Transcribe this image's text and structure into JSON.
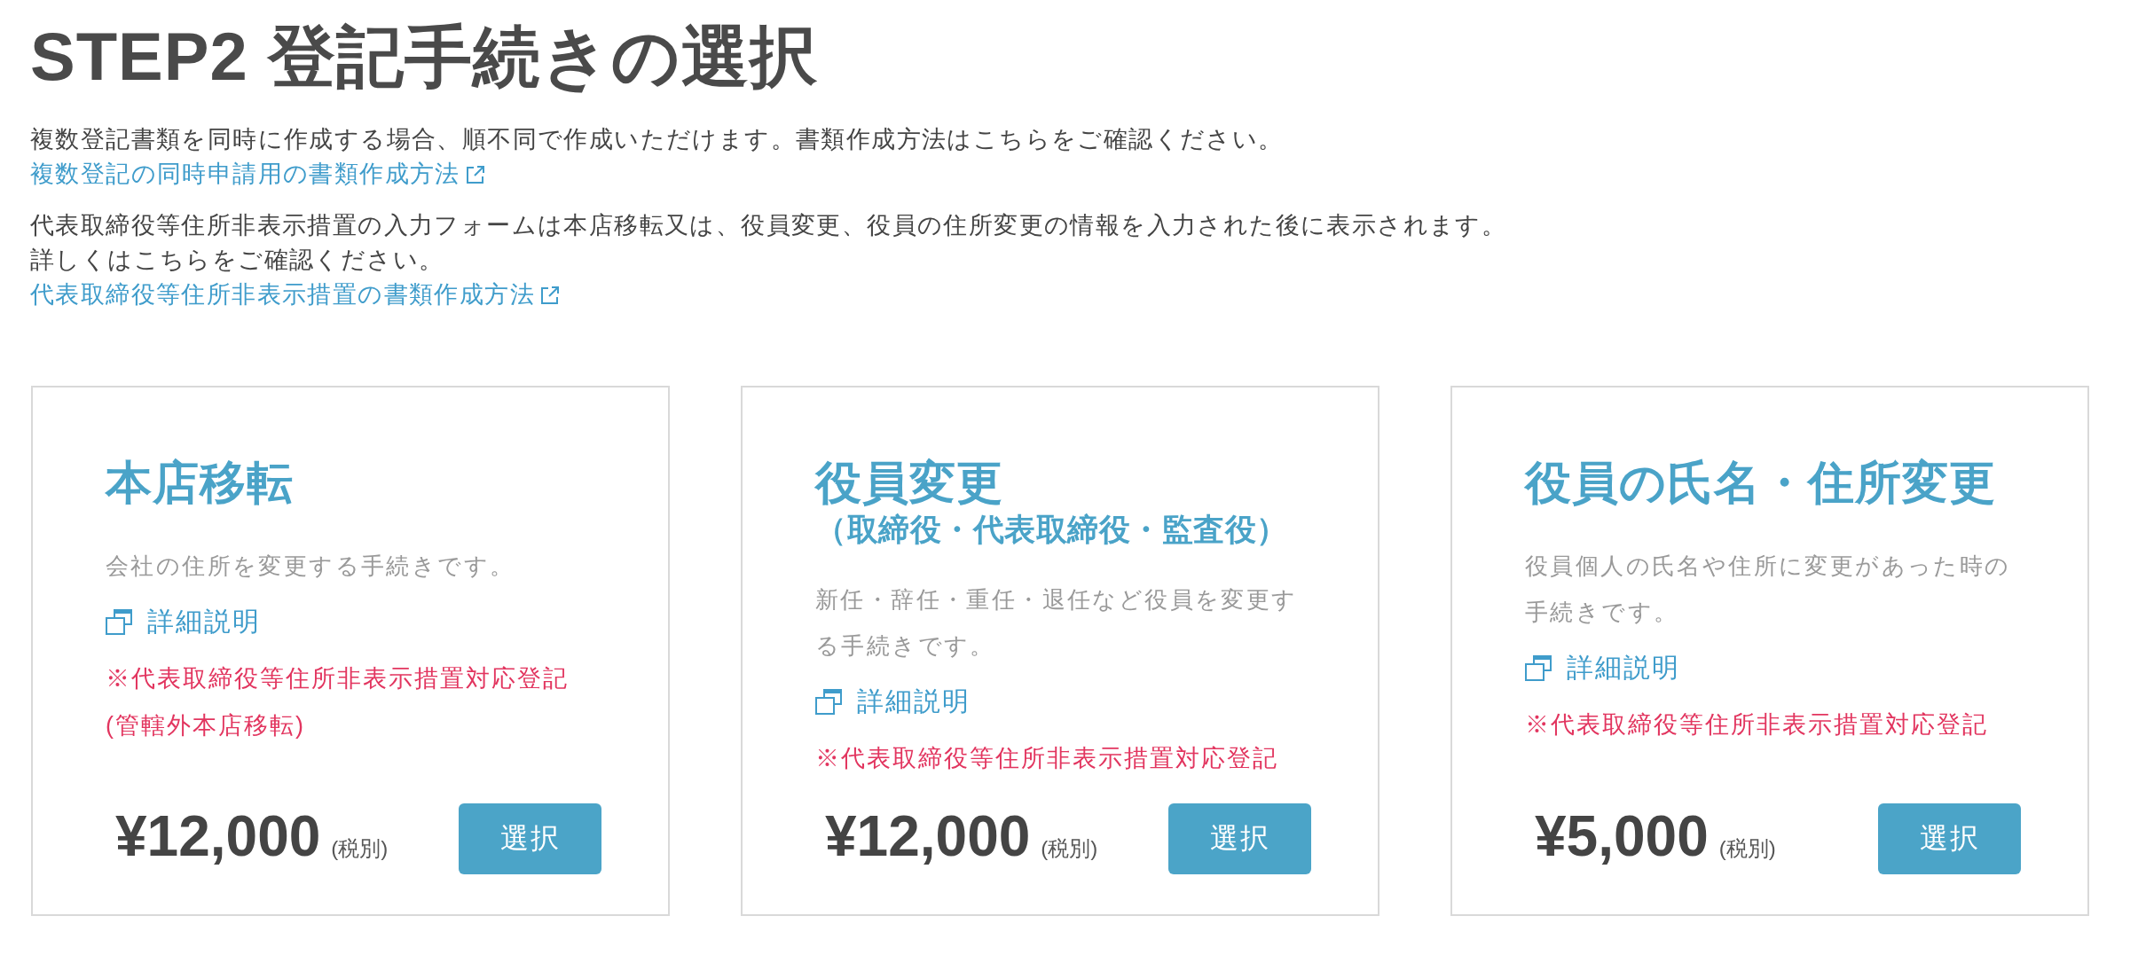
{
  "page_title": "STEP2 登記手続きの選択",
  "notices": [
    {
      "lines": [
        "複数登記書類を同時に作成する場合、順不同で作成いただけます。書類作成方法はこちらをご確認ください。"
      ],
      "link": "複数登記の同時申請用の書類作成方法"
    },
    {
      "lines": [
        "代表取締役等住所非表示措置の入力フォームは本店移転又は、役員変更、役員の住所変更の情報を入力された後に表示されます。",
        "詳しくはこちらをご確認ください。"
      ],
      "link": "代表取締役等住所非表示措置の書類作成方法"
    }
  ],
  "cards": [
    {
      "title": "本店移転",
      "description": "会社の住所を変更する手続きです。",
      "detail_link": "詳細説明",
      "note": "※代表取締役等住所非表示措置対応登記(管轄外本店移転)",
      "price": "¥12,000",
      "tax_note": "(税別)",
      "button": "選択"
    },
    {
      "title": "役員変更",
      "subtitle": "（取締役・代表取締役・監査役）",
      "description": "新任・辞任・重任・退任など役員を変更する手続きです。",
      "detail_link": "詳細説明",
      "note": "※代表取締役等住所非表示措置対応登記",
      "price": "¥12,000",
      "tax_note": "(税別)",
      "button": "選択"
    },
    {
      "title": "役員の氏名・住所変更",
      "description": "役員個人の氏名や住所に変更があった時の手続きです。",
      "detail_link": "詳細説明",
      "note": "※代表取締役等住所非表示措置対応登記",
      "price": "¥5,000",
      "tax_note": "(税別)",
      "button": "選択"
    }
  ]
}
